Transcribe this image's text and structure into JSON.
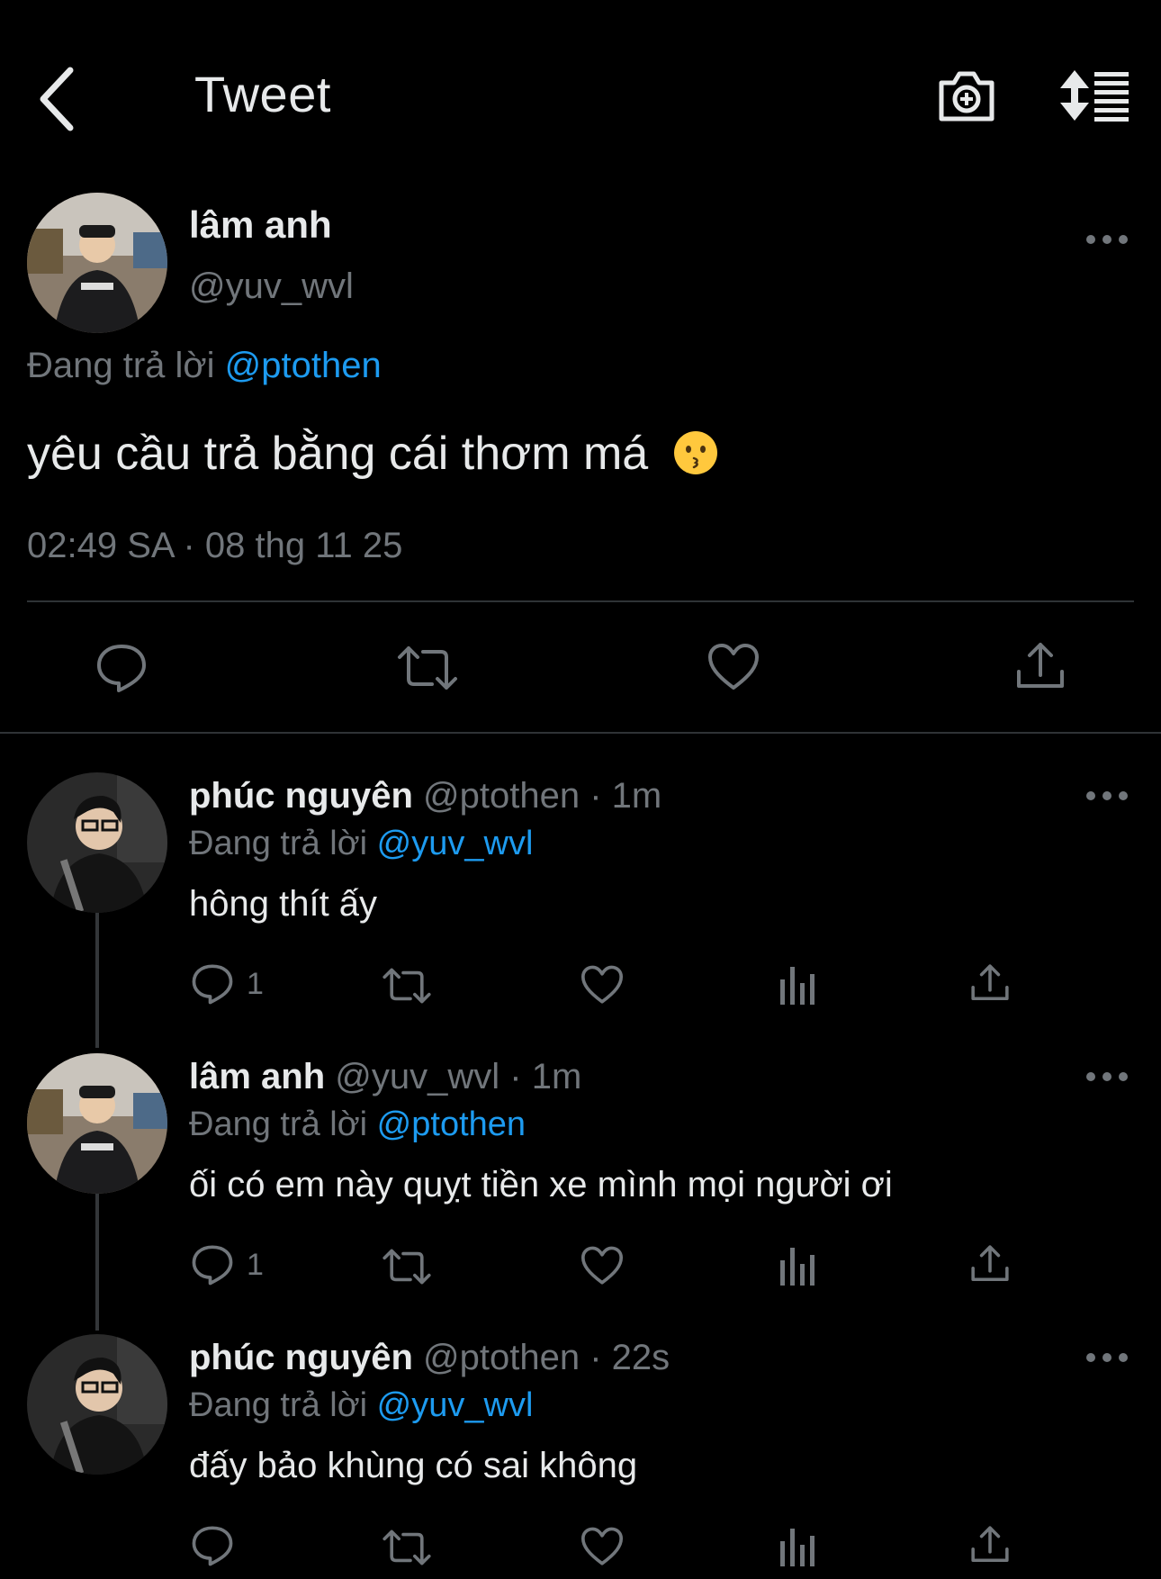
{
  "header": {
    "title": "Tweet"
  },
  "main_tweet": {
    "name": "lâm anh",
    "handle": "@yuv_wvl",
    "replying_prefix": "Đang trả lời",
    "replying_to": "@ptothen",
    "text": "yêu cầu trả bằng cái thơm má",
    "emoji": "kissing-face",
    "timestamp": "02:49 SA · 08 thg 11 25"
  },
  "replies": [
    {
      "name": "phúc nguyên",
      "handle": "@ptothen",
      "time": "· 1m",
      "replying_prefix": "Đang trả lời",
      "replying_to": "@yuv_wvl",
      "text": "hông thít ấy",
      "reply_count": "1"
    },
    {
      "name": "lâm anh",
      "handle": "@yuv_wvl",
      "time": "· 1m",
      "replying_prefix": "Đang trả lời",
      "replying_to": "@ptothen",
      "text": "ối có em này quỵt tiền xe mình mọi người ơi",
      "reply_count": "1"
    },
    {
      "name": "phúc nguyên",
      "handle": "@ptothen",
      "time": "· 22s",
      "replying_prefix": "Đang trả lời",
      "replying_to": "@yuv_wvl",
      "text": "đấy bảo khùng có sai không",
      "reply_count": ""
    }
  ],
  "colors": {
    "background": "#000000",
    "text": "#e7e9ea",
    "secondary": "#71767b",
    "accent": "#1d9bf0",
    "divider": "#2f3336"
  }
}
